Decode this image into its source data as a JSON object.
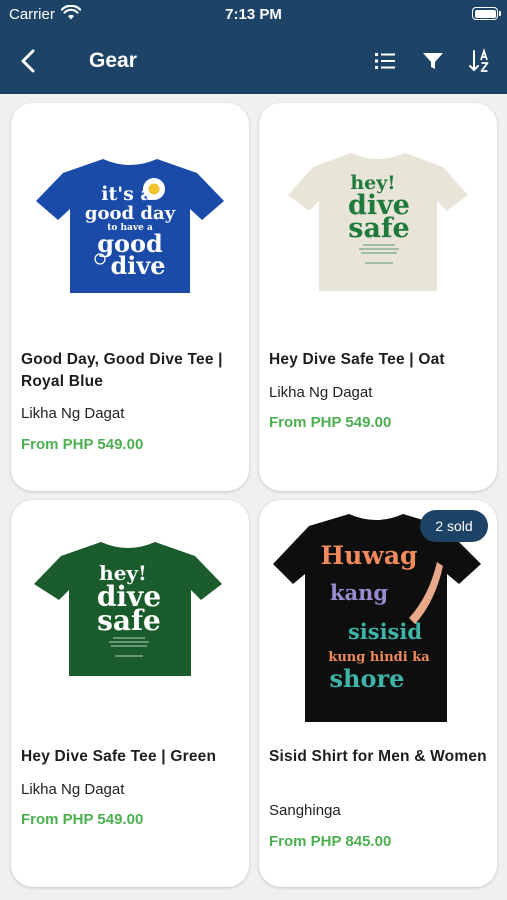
{
  "status_bar": {
    "carrier": "Carrier",
    "time": "7:13 PM"
  },
  "header": {
    "title": "Gear"
  },
  "icons": {
    "back": "chevron-left-icon",
    "list": "list-view-icon",
    "filter": "filter-icon",
    "sort": "sort-az-icon"
  },
  "colors": {
    "header_bg": "#1d4466",
    "price": "#4caf50",
    "badge_bg": "#1d4466"
  },
  "products": [
    {
      "name": "Good Day, Good Dive Tee | Royal Blue",
      "seller": "Likha Ng Dagat",
      "price": "From PHP 549.00",
      "image_text": [
        "it's a",
        "good day",
        "to have a",
        "good",
        "dive"
      ]
    },
    {
      "name": "Hey Dive Safe Tee | Oat",
      "seller": "Likha Ng Dagat",
      "price": "From PHP 549.00",
      "image_text": [
        "hey!",
        "dive",
        "safe"
      ]
    },
    {
      "name": "Hey Dive Safe Tee | Green",
      "seller": "Likha Ng Dagat",
      "price": "From PHP 549.00",
      "image_text": [
        "hey!",
        "dive",
        "safe"
      ]
    },
    {
      "name": "Sisid Shirt for Men & Women",
      "seller": "Sanghinga",
      "price": "From PHP 845.00",
      "badge": "2 sold",
      "image_text": [
        "Huwag",
        "kang",
        "sisisid",
        "kung hindi ka",
        "shore"
      ]
    }
  ]
}
